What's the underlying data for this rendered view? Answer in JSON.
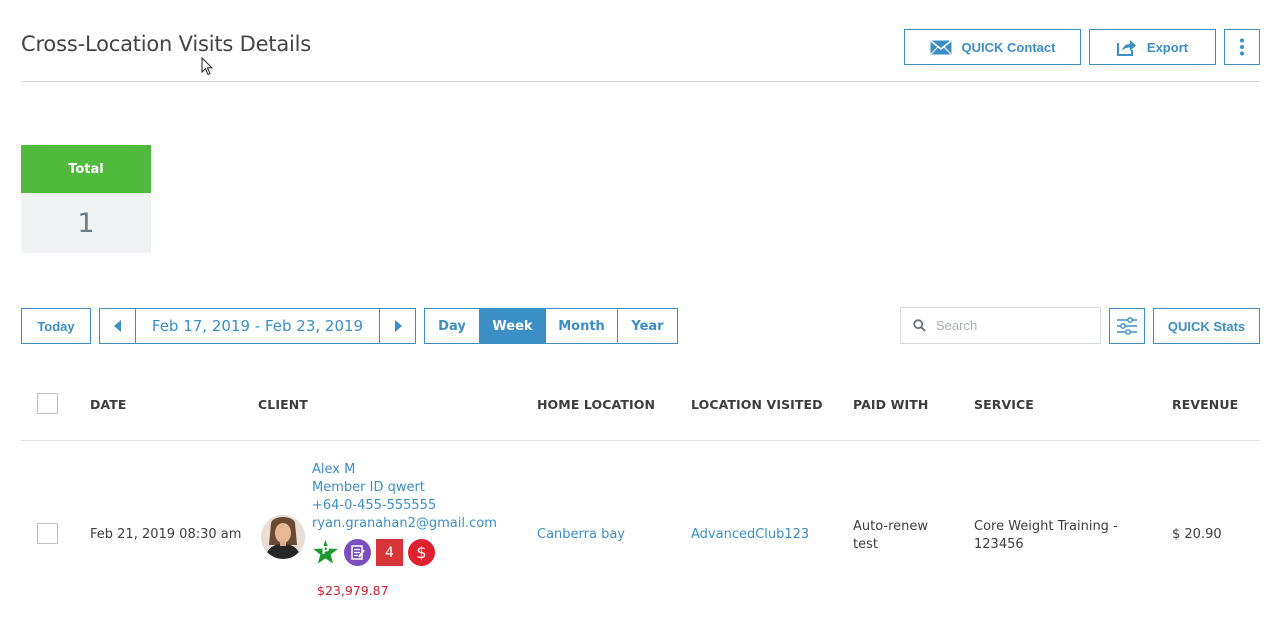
{
  "header": {
    "title": "Cross-Location Visits Details",
    "quick_contact_label": "QUICK Contact",
    "export_label": "Export"
  },
  "summary": {
    "total_label": "Total",
    "total_value": "1"
  },
  "toolbar": {
    "today_label": "Today",
    "date_range": "Feb 17, 2019 - Feb 23, 2019",
    "periods": [
      "Day",
      "Week",
      "Month",
      "Year"
    ],
    "active_period": "Week",
    "search_placeholder": "Search",
    "quick_stats_label": "QUICK Stats"
  },
  "table": {
    "columns": [
      "DATE",
      "CLIENT",
      "HOME LOCATION",
      "LOCATION VISITED",
      "PAID WITH",
      "SERVICE",
      "REVENUE"
    ],
    "rows": [
      {
        "date": "Feb 21, 2019 08:30 am",
        "client": {
          "name": "Alex M",
          "member_id": "Member ID qwert",
          "phone": "+64-0-455-555555",
          "email": "ryan.granahan2@gmail.com",
          "badges": [
            "P",
            "",
            "4",
            "$"
          ],
          "balance": "$23,979.87"
        },
        "home_location": "Canberra bay",
        "location_visited": "AdvancedClub123",
        "paid_with_line1": "Auto-renew",
        "paid_with_line2": "test",
        "service_line1": "Core Weight Training -",
        "service_line2": "123456",
        "revenue": "$ 20.90"
      }
    ]
  },
  "colors": {
    "accent": "#3b8fc5",
    "total_header": "#4fba3c",
    "badge_green": "#1a9a2c",
    "badge_purple": "#7b4fc0",
    "badge_red_square": "#d7343a",
    "badge_red_circle": "#e0202e",
    "balance": "#d0202b"
  },
  "icons": [
    "envelope-icon",
    "share-icon",
    "more-vertical-icon",
    "chevron-left-icon",
    "chevron-right-icon",
    "search-icon",
    "filter-sliders-icon",
    "star-icon",
    "notes-icon",
    "dollar-icon"
  ]
}
